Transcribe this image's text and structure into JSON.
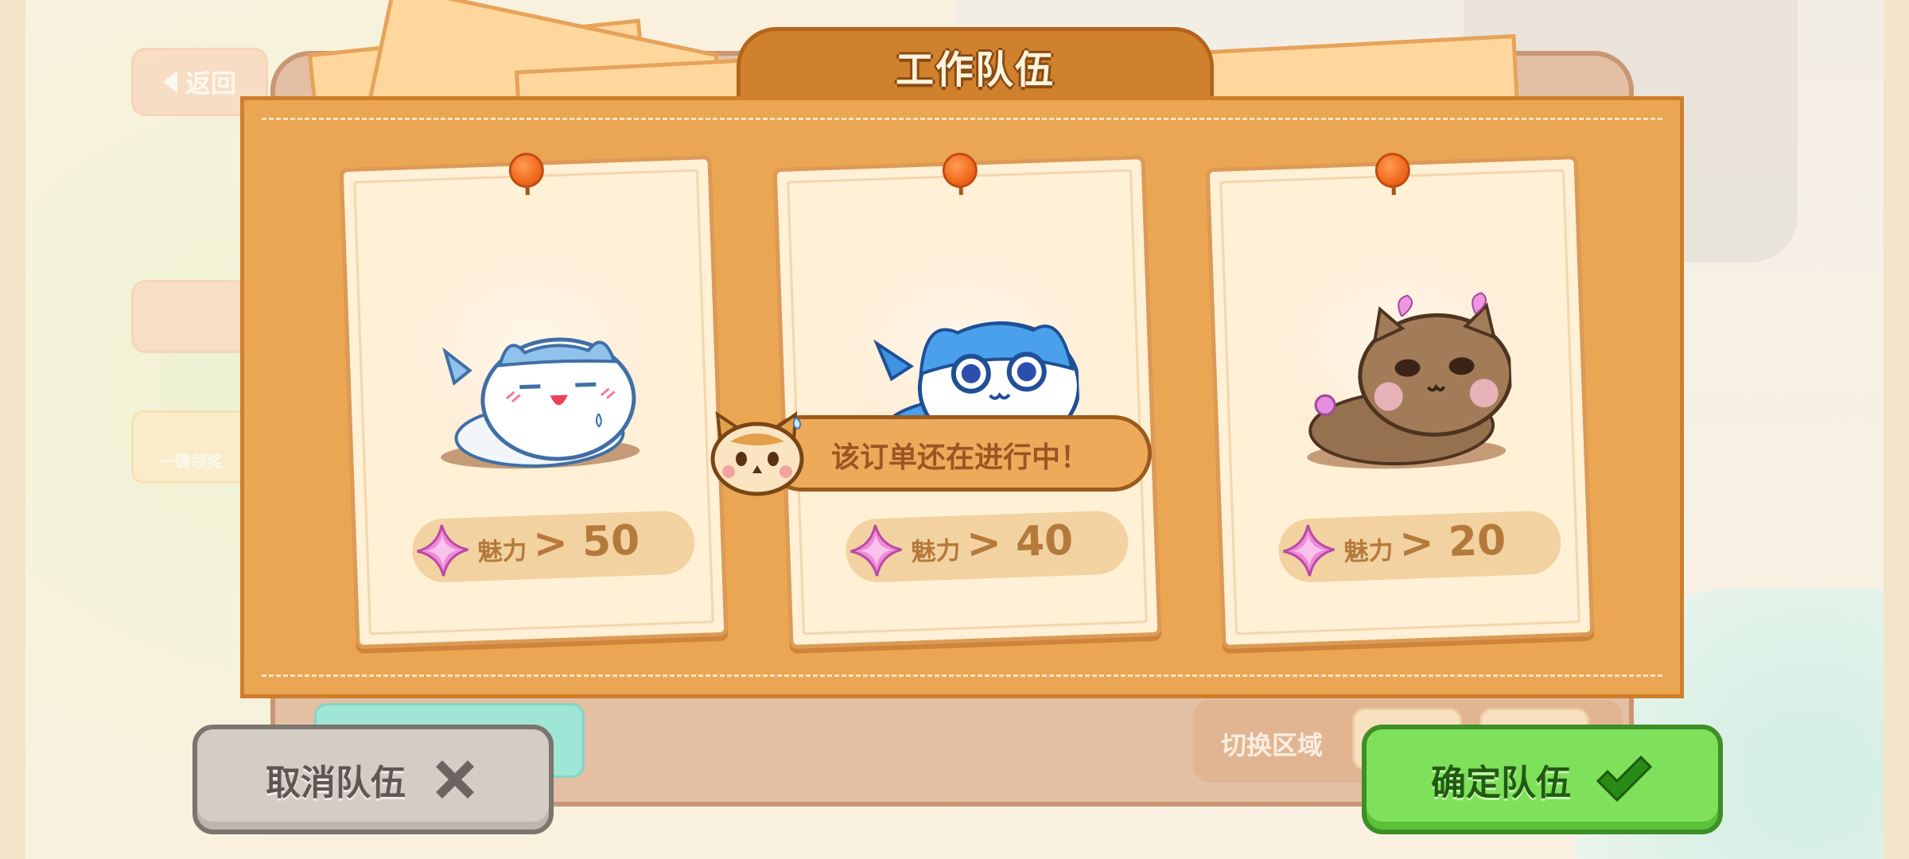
{
  "hud": {
    "back_label": "返回",
    "reward_label": "一键领奖"
  },
  "dialog": {
    "title": "工作队伍",
    "cards": [
      {
        "charm_label": "魅力",
        "charm_value": "> 50"
      },
      {
        "charm_label": "魅力",
        "charm_value": "> 40"
      },
      {
        "charm_label": "魅力",
        "charm_value": "> 20"
      }
    ],
    "toast": "该订单还在进行中！"
  },
  "bottom": {
    "switch_zone_label": "切换区域",
    "cancel_label": "取消队伍",
    "confirm_label": "确定队伍"
  },
  "colors": {
    "panel": "#eba654",
    "card": "#fff0d6",
    "confirm": "#7fe05c",
    "cancel": "#d4cdc6"
  }
}
